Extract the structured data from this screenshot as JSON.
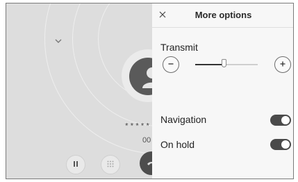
{
  "call": {
    "masked_number": "*****",
    "duration": "00",
    "icons": {
      "collapse": "chevron-down-icon",
      "avatar": "person-icon",
      "pause": "pause-icon",
      "keypad": "keypad-icon",
      "end_call": "end-call-icon"
    }
  },
  "options_panel": {
    "title": "More options",
    "close_icon": "close-icon",
    "transmit": {
      "label": "Transmit",
      "minus_icon": "minus-icon",
      "plus_icon": "plus-icon",
      "level": 0.45
    },
    "toggles": [
      {
        "label": "Navigation",
        "on": true
      },
      {
        "label": "On hold",
        "on": true
      }
    ]
  },
  "colors": {
    "panel_background": "#f7f7f7",
    "call_background": "#dddddd",
    "toggle_on": "#4a4a4a",
    "end_call": "#4d4d4d"
  }
}
